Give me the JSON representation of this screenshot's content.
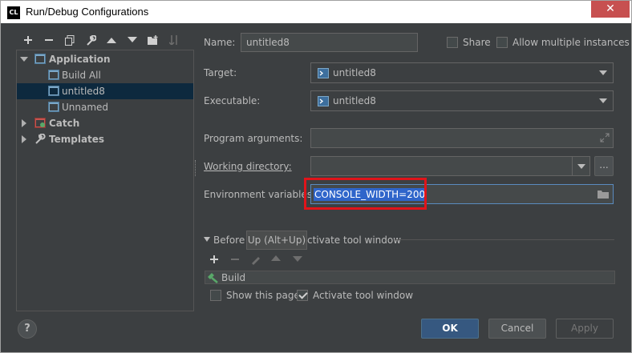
{
  "window": {
    "title": "Run/Debug Configurations",
    "app_icon_text": "CL",
    "close_glyph": "✕"
  },
  "left_toolbar": {
    "icons": [
      "add-icon",
      "remove-icon",
      "copy-icon",
      "wrench-icon",
      "move-up-icon",
      "move-down-icon",
      "folder-add-icon",
      "sort-icon"
    ]
  },
  "tree": {
    "application": "Application",
    "build_all": "Build All",
    "untitled8": "untitled8",
    "unnamed": "Unnamed",
    "catch": "Catch",
    "templates": "Templates"
  },
  "form": {
    "name_label": "Name:",
    "name_value": "untitled8",
    "share_label": "Share",
    "allow_multiple_label": "Allow multiple instances",
    "target_label": "Target:",
    "target_value": "untitled8",
    "executable_label": "Executable:",
    "executable_value": "untitled8",
    "program_args_label": "Program arguments:",
    "working_dir_label": "Working directory:",
    "env_vars_label": "Environment variables:",
    "env_vars_value": "CONSOLE_WIDTH=200"
  },
  "before_launch": {
    "title_left": "Before l",
    "title_right": "ctivate tool window",
    "tooltip": "Up (Alt+Up)",
    "build_item": "Build",
    "show_this_page_label": "Show this page",
    "activate_tool_window_label": "Activate tool window"
  },
  "buttons": {
    "ok": "OK",
    "cancel": "Cancel",
    "apply": "Apply",
    "help": "?"
  },
  "colors": {
    "background": "#3c3f41",
    "selection": "#0d293e",
    "highlight_box": "#e0141a",
    "text_selection": "#2f65ca",
    "primary_button": "#365880"
  }
}
